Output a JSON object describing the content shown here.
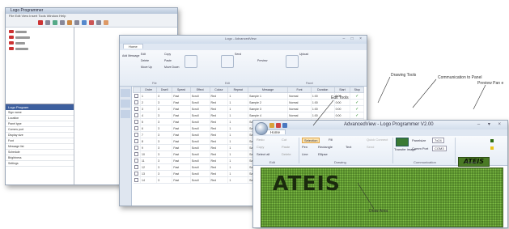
{
  "app": {
    "title": "AdvancedView - Logo Programmer V2.00",
    "home_tab": "Home"
  },
  "back_window": {
    "title": "Logo Programmer",
    "menu": "File  Edit  View  Insert  Tools  Window  Help",
    "side_header": "Logo Program",
    "side_items": [
      "Sign name",
      "Location",
      "Panel type",
      "Comms port",
      "Display size",
      "Font",
      "Message list",
      "Schedule",
      "Brightness",
      "Settings"
    ]
  },
  "mid_window": {
    "title": "Logo - AdvancedView",
    "tab": "Home",
    "ribbon_items": [
      "Add Message",
      "Edit",
      "Delete",
      "Copy",
      "Paste",
      "Move Up",
      "Move Down",
      "Send",
      "Preview",
      "Upload"
    ],
    "groups": [
      "File",
      "Edit",
      "Panel"
    ],
    "columns": [
      "",
      "Order",
      "Dwell",
      "Speed",
      "Effect",
      "Colour",
      "Repeat",
      "Message",
      "Font",
      "Duration",
      "Start",
      "Stop"
    ],
    "rows": [
      [
        "1",
        "3",
        "Fast",
        "Scroll",
        "Red",
        "1",
        "Sample 1",
        "Normal",
        "1:00",
        "0:00"
      ],
      [
        "2",
        "3",
        "Fast",
        "Scroll",
        "Red",
        "1",
        "Sample 2",
        "Normal",
        "1:00",
        "0:00"
      ],
      [
        "3",
        "3",
        "Fast",
        "Scroll",
        "Red",
        "1",
        "Sample 3",
        "Normal",
        "1:00",
        "0:00"
      ],
      [
        "4",
        "3",
        "Fast",
        "Scroll",
        "Red",
        "1",
        "Sample 4",
        "Normal",
        "1:00",
        "0:00"
      ],
      [
        "5",
        "3",
        "Fast",
        "Scroll",
        "Red",
        "1",
        "Sample 5",
        "Normal",
        "1:00",
        "0:00"
      ],
      [
        "6",
        "3",
        "Fast",
        "Scroll",
        "Red",
        "1",
        "Sample 6",
        "Normal",
        "1:00",
        "0:00"
      ],
      [
        "7",
        "3",
        "Fast",
        "Scroll",
        "Red",
        "1",
        "Sample 7",
        "Normal",
        "1:00",
        "0:00"
      ],
      [
        "8",
        "3",
        "Fast",
        "Scroll",
        "Red",
        "1",
        "Sample 8",
        "Normal",
        "1:00",
        "0:00"
      ],
      [
        "9",
        "3",
        "Fast",
        "Scroll",
        "Red",
        "1",
        "Sample 9",
        "Normal",
        "1:00",
        "0:00"
      ],
      [
        "10",
        "3",
        "Fast",
        "Scroll",
        "Red",
        "1",
        "Sample 10",
        "Normal",
        "1:00",
        "0:00"
      ],
      [
        "11",
        "3",
        "Fast",
        "Scroll",
        "Red",
        "1",
        "Sample 11",
        "Normal",
        "1:00",
        "0:00"
      ],
      [
        "12",
        "3",
        "Fast",
        "Scroll",
        "Red",
        "1",
        "Sample 12",
        "Normal",
        "1:00",
        "0:00"
      ],
      [
        "13",
        "3",
        "Fast",
        "Scroll",
        "Red",
        "1",
        "Sample 13",
        "Normal",
        "1:00",
        "0:00"
      ],
      [
        "14",
        "3",
        "Fast",
        "Scroll",
        "Red",
        "1",
        "Sample 14",
        "Normal",
        "1:00",
        "0:00"
      ]
    ]
  },
  "front_window": {
    "edit_items": [
      "Redo",
      "Copy",
      "Select all",
      "Cut",
      "Paste",
      "Delete"
    ],
    "drawing_items": [
      "Selection",
      "Fill",
      "Pen",
      "Rectangle",
      "Text",
      "Line",
      "Ellipse"
    ],
    "comm_items": [
      "Transfer image",
      "Panelsize",
      "Comm Port",
      "Quick Connect",
      "Send"
    ],
    "comm_values": {
      "panelsize": "7x24",
      "port": "COM3"
    },
    "groups": {
      "edit": "Edit",
      "drawing": "Drawing",
      "communication": "Communication",
      "preview": "Preview"
    },
    "led_text": "ATEIS",
    "preview_text": "ATEIS"
  },
  "callouts": {
    "edit_tools": "Edit Tools",
    "drawing_tools": "Drawing Tools",
    "communication": "Communication to Panel",
    "preview": "Preview Pan e",
    "draw_area": "Draw Area"
  },
  "colors": {
    "led_green": "#6aa33a",
    "ribbon_blue": "#dfe7f2",
    "check_green": "#2b8a2b"
  }
}
